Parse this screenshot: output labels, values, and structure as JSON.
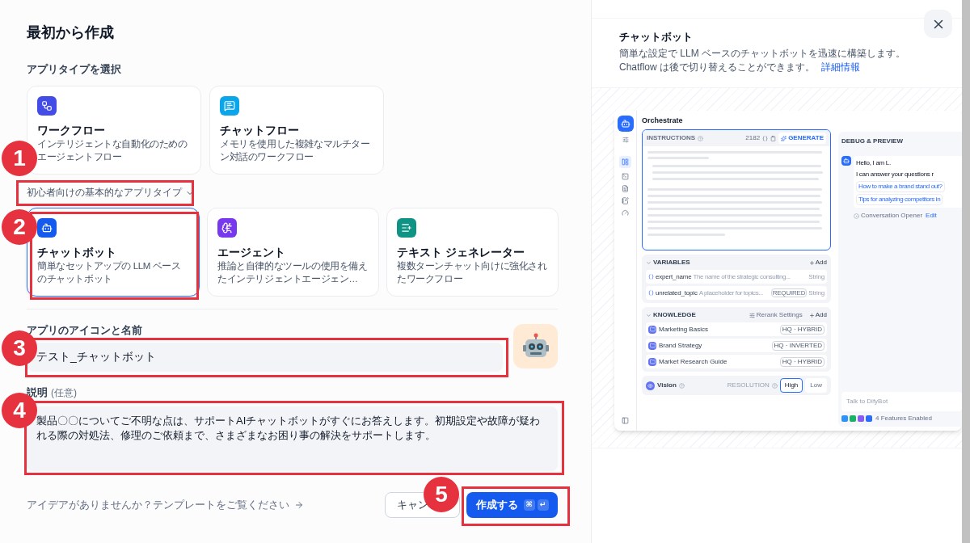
{
  "title": "最初から作成",
  "section_label": "アプリタイプを選択",
  "advanced_types": [
    {
      "kind": "workflow",
      "name": "ワークフロー",
      "description": "インテリジェントな自動化のためのエージェントフロー",
      "color": "#444ce7",
      "selected": false
    },
    {
      "kind": "chatflow",
      "name": "チャットフロー",
      "description": "メモリを使用した複雑なマルチターン対話のワークフロー",
      "color": "#0ba5ec",
      "selected": false
    }
  ],
  "basic_toggle": {
    "label": "初心者向けの基本的なアプリタイプ",
    "expanded": true
  },
  "basic_types": [
    {
      "kind": "chatbot",
      "name": "チャットボット",
      "description": "簡単なセットアップの LLM ベースのチャットボット",
      "color": "#155aef",
      "selected": true
    },
    {
      "kind": "agent",
      "name": "エージェント",
      "description": "推論と自律的なツールの使用を備えたインテリジェントエージェン…",
      "color": "#7839ee",
      "selected": false
    },
    {
      "kind": "text",
      "name": "テキスト ジェネレーター",
      "description": "複数ターンチャット向けに強化されたワークフロー",
      "color": "#0e9384",
      "selected": false
    }
  ],
  "name_field": {
    "label": "アプリのアイコンと名前",
    "value": "テスト_チャットボット"
  },
  "description_field": {
    "label": "説明",
    "optional": "(任意)",
    "value": "製品〇〇についてご不明な点は、サポートAIチャットボットがすぐにお答えします。初期設定や故障が疑われる際の対処法、修理のご依頼まで、さまざまなお困り事の解決をサポートします。"
  },
  "template_link": "アイデアがありませんか？テンプレートをご覧ください",
  "cancel_button": "キャン",
  "create_button": {
    "label": "作成する",
    "shortcut": [
      "⌘",
      "↵"
    ]
  },
  "preview": {
    "title": "チャットボット",
    "description": [
      "簡単な設定で LLM ベースのチャットボットを迅速に構築します。",
      "Chatflow は後で切り替えることができます。"
    ],
    "link": "詳細情報",
    "mock": {
      "title": "Orchestrate",
      "instructions": {
        "label": "INSTRUCTIONS",
        "count": "2182",
        "generate": "GENERATE"
      },
      "variables": {
        "label": "VARIABLES",
        "add": "Add",
        "items": [
          {
            "name": "expert_name",
            "description": "The name of the strategic consulting...",
            "required": false,
            "type": "String"
          },
          {
            "name": "unrelated_topic",
            "description": "A placeholder for topics...",
            "required": true,
            "type": "String"
          }
        ],
        "required_label": "REQUIRED"
      },
      "knowledge": {
        "label": "KNOWLEDGE",
        "rerank": "Rerank Settings",
        "add": "Add",
        "items": [
          {
            "name": "Marketing Basics",
            "tag": "HQ · HYBRID"
          },
          {
            "name": "Brand Strategy",
            "tag": "HQ · INVERTED"
          },
          {
            "name": "Market Research Guide",
            "tag": "HQ · HYBRID"
          }
        ]
      },
      "vision": {
        "label": "Vision",
        "resolution": "RESOLUTION",
        "options": [
          {
            "label": "High",
            "selected": true
          },
          {
            "label": "Low",
            "selected": false
          }
        ]
      },
      "debug": {
        "title": "DEBUG & PREVIEW",
        "greeting": [
          "Hello, I am L.",
          "I can answer your questions r"
        ],
        "suggestions": [
          "How to make a brand stand out?",
          "Tips for analyzing competitors in"
        ],
        "opener": "Conversation Opener",
        "edit": "Edit",
        "placeholder": "Talk to DifyBot",
        "features": "4 Features Enabled"
      }
    }
  },
  "annotations": [
    {
      "label": "1"
    },
    {
      "label": "2"
    },
    {
      "label": "3"
    },
    {
      "label": "4"
    },
    {
      "label": "5"
    }
  ]
}
